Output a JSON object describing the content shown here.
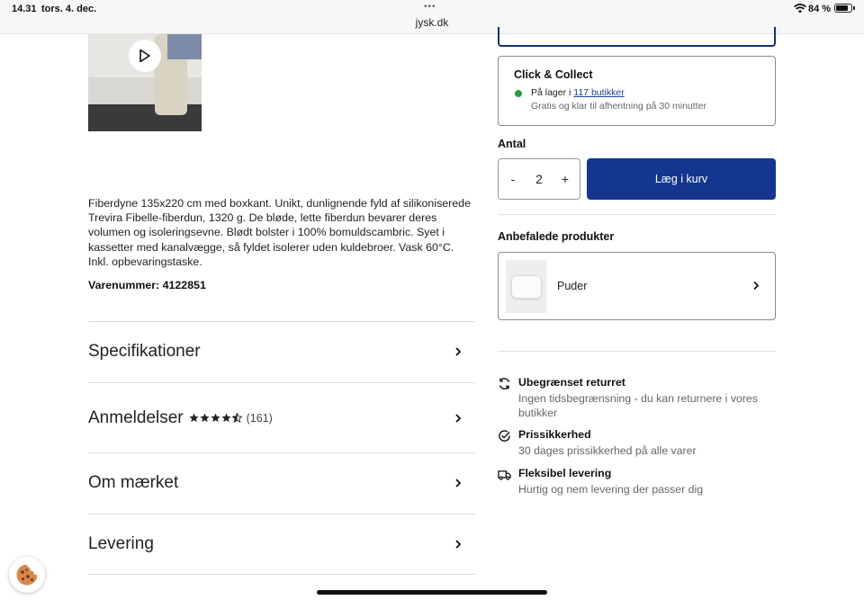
{
  "status_bar": {
    "time": "14.31",
    "date": "tors. 4. dec.",
    "url": "jysk.dk",
    "battery": "84 %"
  },
  "description": "Fiberdyne 135x220 cm med boxkant. Unikt, dunlignende fyld af silikoniserede Trevira Fibelle-fiberdun, 1320 g. De bløde, lette fiberdun bevarer deres volumen og isoleringsevne. Blødt bolster i 100% bomuldscambric. Syet i kassetter med ka­nalvægge, så fyldet isolerer uden kuldebroer. Vask 60°C. Inkl. opbevaringstaske.",
  "item_number": "Varenummer: 4122851",
  "accordion": {
    "specs": "Specifikationer",
    "reviews": "Anmeldelser",
    "reviews_count": "(161)",
    "reviews_rating": 4.5,
    "brand": "Om mærket",
    "delivery": "Levering"
  },
  "click_collect": {
    "title": "Click & Collect",
    "stock_prefix": "På lager i ",
    "stores_link": "117 butikker",
    "sub": "Gratis og klar til afhentning på 30 minutter",
    "stock_color": "#2c9a46"
  },
  "quantity": {
    "label": "Antal",
    "minus": "-",
    "value": "2",
    "plus": "+"
  },
  "cart_button": "Læg i kurv",
  "recommended": {
    "label": "Anbefalede produkter",
    "item": "Puder"
  },
  "usps": [
    {
      "icon": "refresh-icon",
      "title": "Ubegrænset returret",
      "text": "Ingen tidsbegrænsning - du kan returnere i vores butikker"
    },
    {
      "icon": "check-circle-icon",
      "title": "Prissikkerhed",
      "text": "30 dages prissikkerhed på alle varer"
    },
    {
      "icon": "truck-icon",
      "title": "Fleksibel levering",
      "text": "Hurtig og nem levering der passer dig"
    }
  ],
  "colors": {
    "primary": "#14368e",
    "link": "#1b3f8f"
  }
}
